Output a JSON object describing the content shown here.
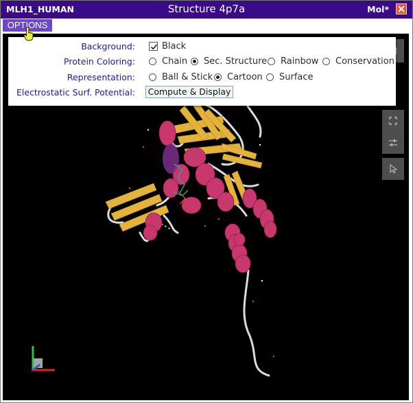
{
  "window": {
    "left_title": "MLH1_HUMAN",
    "center_title": "Structure 4p7a",
    "right_title": "Mol*"
  },
  "menu": {
    "options_label": "OPTIONS"
  },
  "options": {
    "background": {
      "label": "Background:",
      "option": "Black",
      "checked": true
    },
    "protein_coloring": {
      "label": "Protein Coloring:",
      "choices": [
        "Chain",
        "Sec. Structure",
        "Rainbow",
        "Conservation"
      ],
      "selected": "Sec. Structure"
    },
    "representation": {
      "label": "Representation:",
      "choices": [
        "Ball & Stick",
        "Cartoon",
        "Surface"
      ],
      "selected": "Cartoon"
    },
    "electrostatic": {
      "label": "Electrostatic Surf. Potential:",
      "button_label": "Compute & Display"
    }
  },
  "viewer": {
    "background": "#000000",
    "toolbar_icons": [
      "screenshot-icon",
      "expand-icon",
      "settings-sliders-icon",
      "select-cursor-icon"
    ]
  },
  "colors": {
    "title_bar": "#3a0b86",
    "options_button": "#6a48c7",
    "close_button": "#e5533a",
    "label_text": "#1b1b9a",
    "helix": "#c8386f",
    "sheet": "#e3b33c",
    "coil": "#dcdcdc"
  }
}
